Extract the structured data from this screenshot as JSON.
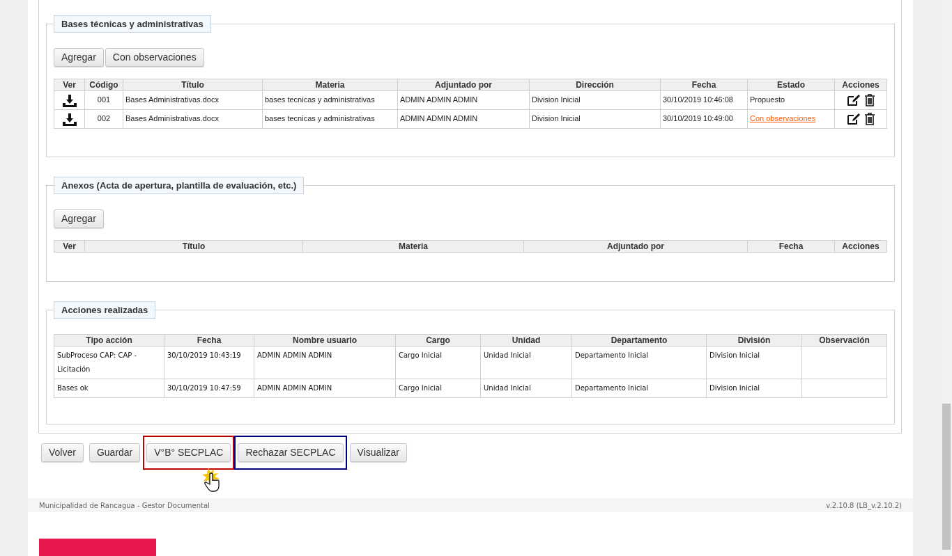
{
  "sections": [
    {
      "kind": "documents",
      "legend": "Bases técnicas y administrativas",
      "buttons": [
        "Agregar",
        "Con observaciones"
      ],
      "table": {
        "columns": [
          "Ver",
          "Código",
          "Título",
          "Materia",
          "Adjuntado por",
          "Dirección",
          "Fecha",
          "Estado",
          "Acciones"
        ],
        "rows": [
          {
            "code": "001",
            "title": "Bases Administrativas.docx",
            "subject": "bases tecnicas y administrativas",
            "by": "ADMIN ADMIN ADMIN",
            "direction": "Division Inicial",
            "date": "30/10/2019 10:46:08",
            "status": {
              "kind": "text",
              "label": "Propuesto"
            }
          },
          {
            "code": "002",
            "title": "Bases Administrativas.docx",
            "subject": "bases tecnicas y administrativas",
            "by": "ADMIN ADMIN ADMIN",
            "direction": "Division Inicial",
            "date": "30/10/2019 10:49:00",
            "status": {
              "kind": "link",
              "label": "Con observaciones"
            }
          }
        ]
      }
    },
    {
      "kind": "annexes",
      "legend": "Anexos (Acta de apertura, plantilla de evaluación, etc.)",
      "buttons": [
        "Agregar"
      ],
      "table": {
        "columns": [
          "Ver",
          "Título",
          "Materia",
          "Adjuntado por",
          "Fecha",
          "Acciones"
        ]
      }
    },
    {
      "kind": "actions",
      "legend": "Acciones realizadas",
      "table": {
        "columns": [
          "Tipo acción",
          "Fecha",
          "Nombre usuario",
          "Cargo",
          "Unidad",
          "Departamento",
          "División",
          "Observación"
        ],
        "rows": [
          [
            "SubProceso CAP: CAP - Licitación",
            "30/10/2019 10:43:19",
            "ADMIN ADMIN ADMIN",
            "Cargo Inicial",
            "Unidad Inicial",
            "Departamento Inicial",
            "Division Inicial",
            ""
          ],
          [
            "Bases ok",
            "30/10/2019 10:47:59",
            "ADMIN ADMIN ADMIN",
            "Cargo Inicial",
            "Unidad Inicial",
            "Departamento Inicial",
            "Division Inicial",
            ""
          ]
        ]
      }
    }
  ],
  "actions": [
    {
      "label": "Volver"
    },
    {
      "label": "Guardar"
    },
    {
      "label": "V°B° SECPLAC",
      "color": "#c00000",
      "pointer": true
    },
    {
      "label": "Rechazar SECPLAC",
      "color": "#00007f"
    },
    {
      "label": "Visualizar"
    }
  ],
  "footer": {
    "left": "Municipalidad de Rancagua - Gestor Documental",
    "right": "v.2.10.8 (LB_v.2.10.2)"
  }
}
